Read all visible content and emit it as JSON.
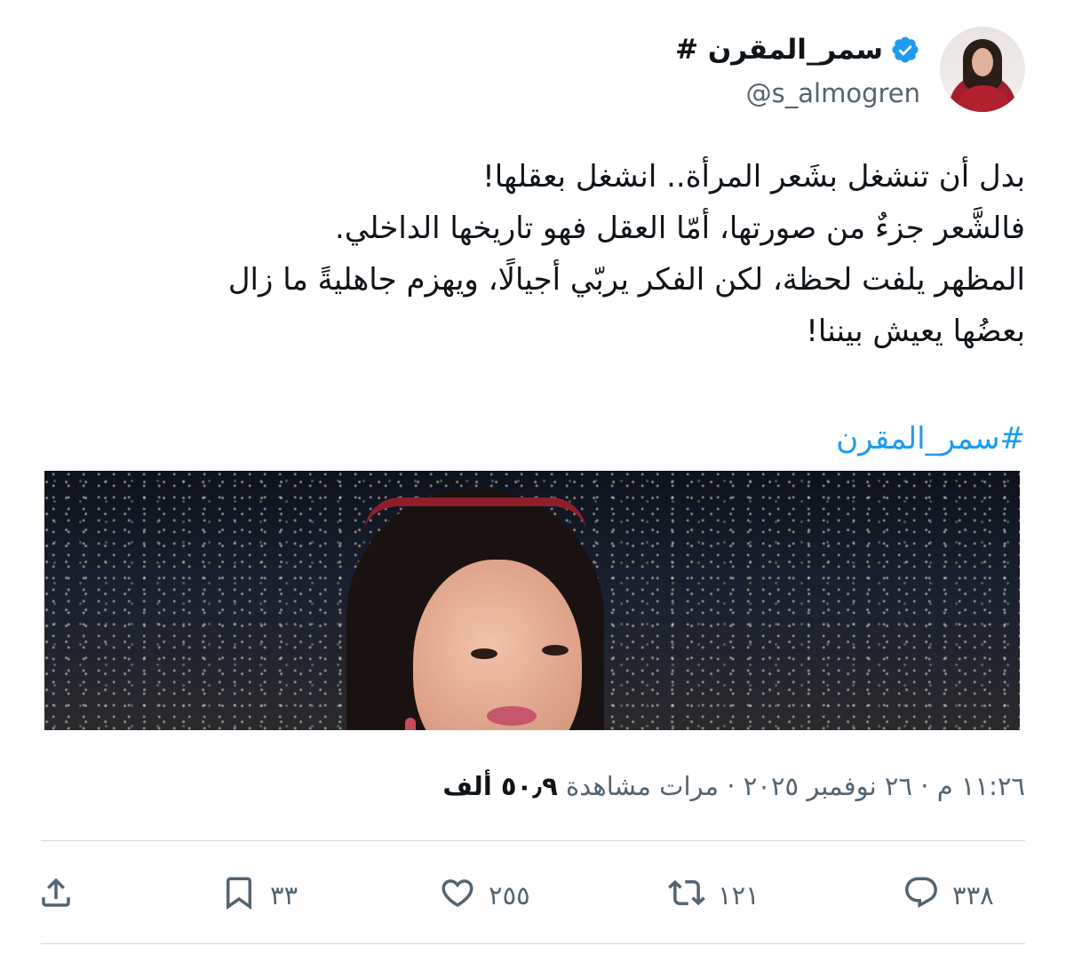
{
  "author": {
    "display_name": "سمر_المقرن #",
    "handle": "@s_almogren",
    "verified": true,
    "verified_color": "#1d9bf0"
  },
  "tweet": {
    "lines": [
      "بدل أن تنشغل بشَعر المرأة.. انشغل بعقلها!",
      "فالشَّعر جزءٌ من صورتها، أمّا العقل فهو تاريخها الداخلي.",
      "المظهر يلفت لحظة، لكن الفكر يربّي أجيالًا، ويهزم جاهليةً ما زال",
      "بعضُها يعيش بيننا!"
    ],
    "hashtag": "#سمر_المقرن",
    "hashtag_color": "#1d9bf0"
  },
  "meta": {
    "time": "١١:٢٦ م",
    "separator": "·",
    "date": "٢٦ نوفمبر ٢٠٢٥",
    "views_count": "٥٠٫٩ ألف",
    "views_label": "مرات مشاهدة"
  },
  "actions": {
    "replies": "٣٣٨",
    "retweets": "١٢١",
    "likes": "٢٥٥",
    "bookmarks": "٣٣"
  },
  "icons": {
    "reply": "reply-icon",
    "retweet": "retweet-icon",
    "like": "heart-icon",
    "bookmark": "bookmark-icon",
    "share": "share-icon",
    "verified": "verified-badge-icon"
  }
}
